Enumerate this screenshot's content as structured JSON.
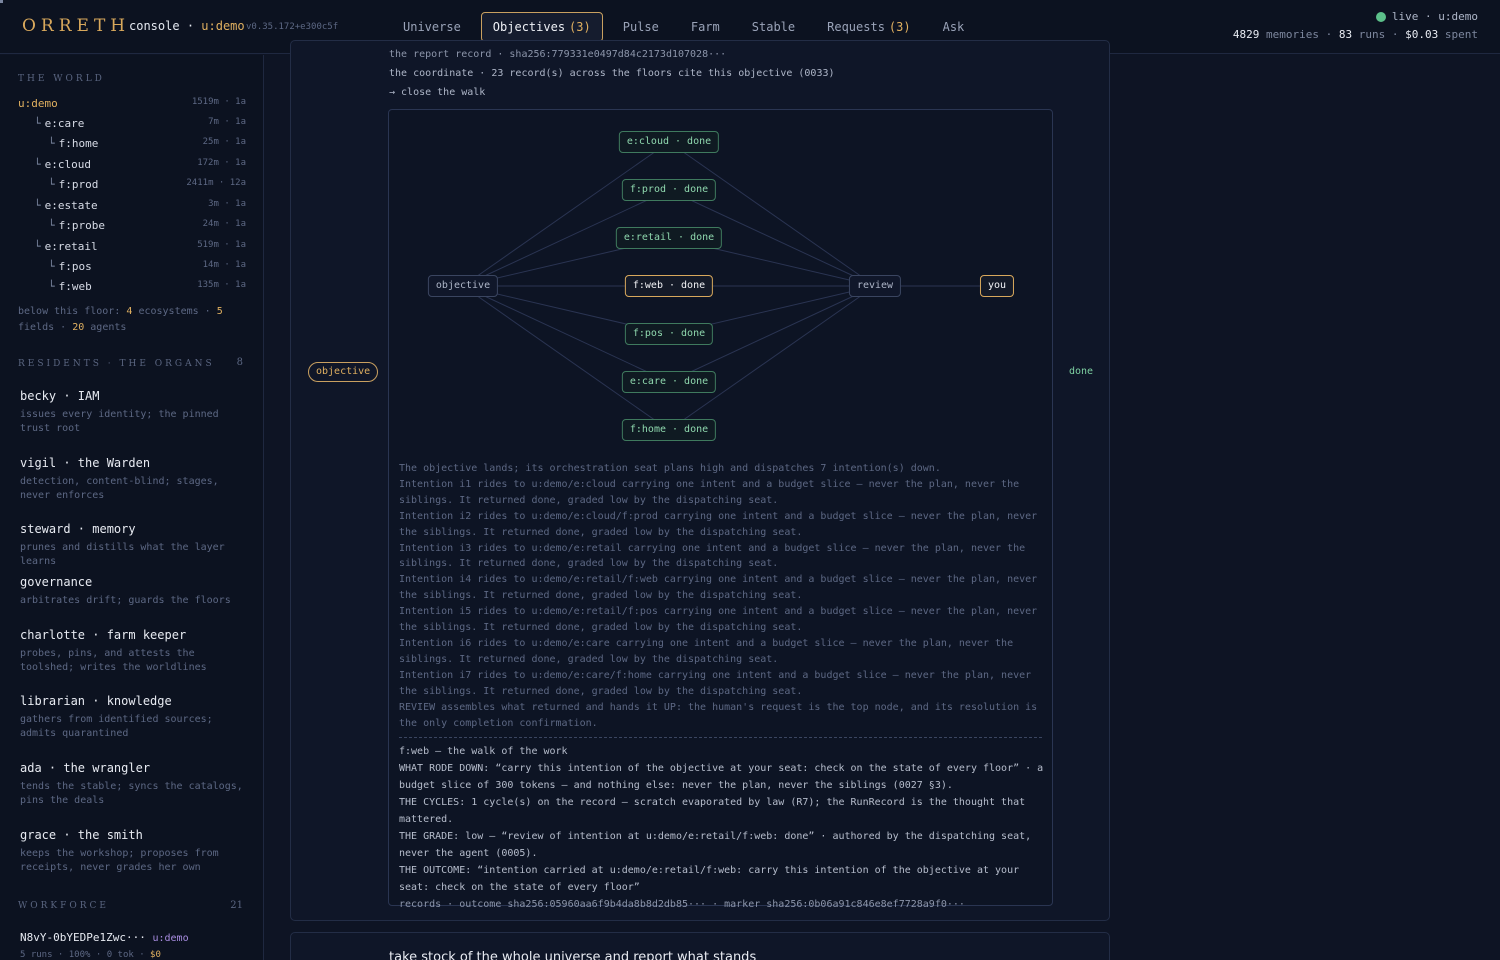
{
  "header": {
    "brand": "ORRETH",
    "console": "console",
    "separator": "·",
    "universe": "u:demo",
    "version": "v0.35.172+e300c5f",
    "nav": [
      {
        "label": "Universe",
        "count": ""
      },
      {
        "label": "Objectives",
        "count": "(3)"
      },
      {
        "label": "Pulse",
        "count": ""
      },
      {
        "label": "Farm",
        "count": ""
      },
      {
        "label": "Stable",
        "count": ""
      },
      {
        "label": "Requests",
        "count": "(3)"
      },
      {
        "label": "Ask",
        "count": ""
      }
    ],
    "live": "live · u:demo",
    "memories": "4829",
    "memories_label": "memories ·",
    "runs": "83",
    "runs_label": "runs ·",
    "spent": "$0.03",
    "spent_label": "spent",
    "status_color": "#5cc08a"
  },
  "sidebar": {
    "world_heading": "THE WORLD",
    "tree": [
      {
        "label": "u:demo",
        "value": "1519m · 1a"
      },
      {
        "label": "e:care",
        "value": "7m · 1a"
      },
      {
        "label": "f:home",
        "value": "25m · 1a"
      },
      {
        "label": "e:cloud",
        "value": "172m · 1a"
      },
      {
        "label": "f:prod",
        "value": "2411m · 12a"
      },
      {
        "label": "e:estate",
        "value": "3m · 1a"
      },
      {
        "label": "f:probe",
        "value": "24m · 1a"
      },
      {
        "label": "e:retail",
        "value": "519m · 1a"
      },
      {
        "label": "f:pos",
        "value": "14m · 1a"
      },
      {
        "label": "f:web",
        "value": "135m · 1a"
      }
    ],
    "below": {
      "prefix": "below this floor:",
      "ecosystems": "4",
      "ecosystems_label": "ecosystems ·",
      "fields": "5",
      "fields_label": "fields ·",
      "agents": "20",
      "agents_label": "agents"
    },
    "residents_heading": "RESIDENTS · THE ORGANS",
    "residents_count": "8",
    "residents": [
      {
        "name": "becky · IAM",
        "desc": "issues every identity; the pinned trust root"
      },
      {
        "name": "vigil · the Warden",
        "desc": "detection, content-blind; stages, never enforces"
      },
      {
        "name": "steward · memory",
        "desc": "prunes and distills what the layer learns"
      },
      {
        "name": "governance",
        "desc": "arbitrates drift; guards the floors"
      },
      {
        "name": "charlotte · farm keeper",
        "desc": "probes, pins, and attests the toolshed; writes the worldlines"
      },
      {
        "name": "librarian · knowledge",
        "desc": "gathers from identified sources; admits quarantined"
      },
      {
        "name": "ada · the wrangler",
        "desc": "tends the stable; syncs the catalogs, pins the deals"
      },
      {
        "name": "grace · the smith",
        "desc": "keeps the workshop; proposes from receipts, never grades her own"
      }
    ],
    "workforce_heading": "WORKFORCE",
    "workforce_count": "21",
    "worker": {
      "id": "N8vY-0bYEDPe1Zwc···",
      "universe": "u:demo",
      "stats": "5 runs · 100% · 0 tok ·",
      "cost": "$0"
    }
  },
  "objective": {
    "report_record": "the report record · sha256:779331e0497d84c2173d107028···",
    "coordinate": "the coordinate · 23 record(s) across the floors cite this objective (0033)",
    "close": "→ close the walk",
    "kind": "objective",
    "state": "done",
    "graph": {
      "source": "objective",
      "intentions": [
        "e:cloud · done",
        "f:prod · done",
        "e:retail · done",
        "f:web · done",
        "f:pos · done",
        "e:care · done",
        "f:home · done"
      ],
      "review": "review",
      "you": "you"
    },
    "narrative": [
      "The objective lands; its orchestration seat plans high and dispatches 7 intention(s) down.",
      "Intention i1 rides to u:demo/e:cloud carrying one intent and a budget slice — never the plan, never the siblings. It returned done, graded low by the dispatching seat.",
      "Intention i2 rides to u:demo/e:cloud/f:prod carrying one intent and a budget slice — never the plan, never the siblings. It returned done, graded low by the dispatching seat.",
      "Intention i3 rides to u:demo/e:retail carrying one intent and a budget slice — never the plan, never the siblings. It returned done, graded low by the dispatching seat.",
      "Intention i4 rides to u:demo/e:retail/f:web carrying one intent and a budget slice — never the plan, never the siblings. It returned done, graded low by the dispatching seat.",
      "Intention i5 rides to u:demo/e:retail/f:pos carrying one intent and a budget slice — never the plan, never the siblings. It returned done, graded low by the dispatching seat.",
      "Intention i6 rides to u:demo/e:care carrying one intent and a budget slice — never the plan, never the siblings. It returned done, graded low by the dispatching seat.",
      "Intention i7 rides to u:demo/e:care/f:home carrying one intent and a budget slice — never the plan, never the siblings. It returned done, graded low by the dispatching seat.",
      "REVIEW assembles what returned and hands it UP: the human's request is the top node, and its resolution is the only completion confirmation."
    ],
    "walk": {
      "title": "f:web — the walk of the work",
      "rode_down": "WHAT RODE DOWN: “carry this intention of the objective at your seat: check on the state of every floor” · a budget slice of 300 tokens — and nothing else: never the plan, never the siblings (0027 §3).",
      "cycles": "THE CYCLES: 1 cycle(s) on the record — scratch evaporated by law (R7); the RunRecord is the thought that mattered.",
      "grade": "THE GRADE: low — “review of intention at u:demo/e:retail/f:web: done” · authored by the dispatching seat, never the agent (0005).",
      "outcome": "THE OUTCOME: “intention carried at u:demo/e:retail/f:web: carry this intention of the objective at your seat: check on the state of every floor”",
      "records": "records · outcome sha256:05960aa6f9b4da8b8d2db85··· · marker sha256:0b06a91c846e8ef7728a9f0···"
    },
    "next_title": "take stock of the whole universe and report what stands"
  }
}
